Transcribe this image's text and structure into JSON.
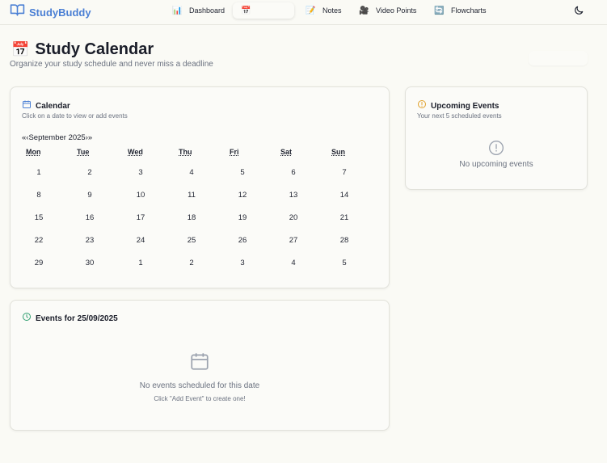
{
  "app": {
    "brand": "StudyBuddy",
    "accent": "#4a7fd4"
  },
  "nav": {
    "items": [
      {
        "label": "Dashboard",
        "icon": "📊"
      },
      {
        "label": "",
        "icon": "📅"
      },
      {
        "label": "Notes",
        "icon": "📝"
      },
      {
        "label": "Video Points",
        "icon": "🎥"
      },
      {
        "label": "Flowcharts",
        "icon": "🔄"
      }
    ],
    "active_index": 1
  },
  "header": {
    "icon": "📅",
    "title": "Study Calendar",
    "subtitle": "Organize your study schedule and never miss a deadline",
    "add_button_label": ""
  },
  "calendar": {
    "title": "Calendar",
    "subtitle": "Click on a date to view or add events",
    "prev_label": "«‹",
    "month_label": "September 2025",
    "next_label": "›»",
    "weekdays": [
      "Mon",
      "Tue",
      "Wed",
      "Thu",
      "Fri",
      "Sat",
      "Sun"
    ],
    "weeks": [
      [
        "1",
        "2",
        "3",
        "4",
        "5",
        "6",
        "7"
      ],
      [
        "8",
        "9",
        "10",
        "11",
        "12",
        "13",
        "14"
      ],
      [
        "15",
        "16",
        "17",
        "18",
        "19",
        "20",
        "21"
      ],
      [
        "22",
        "23",
        "24",
        "25",
        "26",
        "27",
        "28"
      ],
      [
        "29",
        "30",
        "1",
        "2",
        "3",
        "4",
        "5"
      ]
    ]
  },
  "events": {
    "title": "Events for 25/09/2025",
    "empty_message": "No events scheduled for this date",
    "empty_hint": "Click \"Add Event\" to create one!"
  },
  "upcoming": {
    "title": "Upcoming Events",
    "subtitle": "Your next 5 scheduled events",
    "empty_message": "No upcoming events"
  },
  "colors": {
    "calendar_icon": "#4a7fd4",
    "clock_icon": "#2f9e6f",
    "alert_icon": "#e0a02a",
    "muted": "#6b7280"
  }
}
